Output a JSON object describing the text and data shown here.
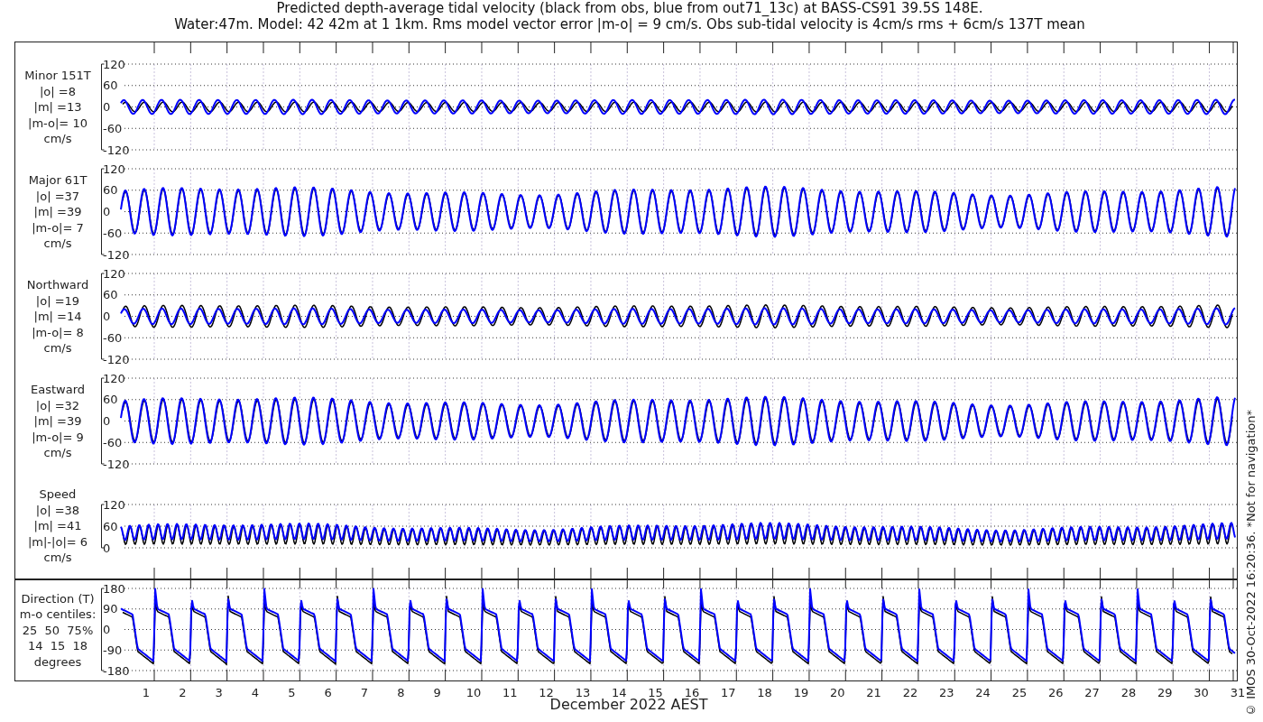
{
  "title": {
    "line1": "Predicted depth-average tidal velocity (black from obs, blue from out71_13c) at BASS-CS91 39.5S 148E.",
    "line2": "Water:47m. Model: 42 42m at 1 1km. Rms model vector error |m-o| = 9 cm/s. Obs sub-tidal velocity is 4cm/s rms + 6cm/s 137T mean"
  },
  "series": [
    {
      "color": "#000000"
    },
    {
      "color": "#0000ff"
    }
  ],
  "panels": [
    {
      "kind": "velocity",
      "label_lines": [
        "Minor 151T",
        "|o| =8",
        "|m| =13",
        "|m-o|= 10",
        "cm/s"
      ],
      "yticks": [
        "120",
        "60",
        "0",
        "-60",
        "-120"
      ]
    },
    {
      "kind": "velocity",
      "label_lines": [
        "Major 61T",
        "|o| =37",
        "|m| =39",
        "|m-o|= 7",
        "cm/s"
      ],
      "yticks": [
        "120",
        "60",
        "0",
        "-60",
        "-120"
      ]
    },
    {
      "kind": "velocity",
      "label_lines": [
        "Northward",
        "|o| =19",
        "|m| =14",
        "|m-o|= 8",
        "cm/s"
      ],
      "yticks": [
        "120",
        "60",
        "0",
        "-60",
        "-120"
      ]
    },
    {
      "kind": "velocity",
      "label_lines": [
        "Eastward",
        "|o| =32",
        "|m| =39",
        "|m-o|= 9",
        "cm/s"
      ],
      "yticks": [
        "120",
        "60",
        "0",
        "-60",
        "-120"
      ]
    },
    {
      "kind": "speed",
      "label_lines": [
        "Speed",
        "|o| =38",
        "|m| =41",
        "|m|-|o|= 6",
        "cm/s"
      ],
      "yticks": [
        "120",
        "60",
        "0"
      ]
    },
    {
      "kind": "direction",
      "label_lines": [
        "Direction (T)",
        "m-o centiles:",
        "25  50  75%",
        "14  15  18",
        "degrees"
      ],
      "yticks": [
        "180",
        "90",
        "0",
        "-90",
        "-180"
      ]
    }
  ],
  "x_axis": {
    "ticks": [
      "1",
      "2",
      "3",
      "4",
      "5",
      "6",
      "7",
      "8",
      "9",
      "10",
      "11",
      "12",
      "13",
      "14",
      "15",
      "16",
      "17",
      "18",
      "19",
      "20",
      "21",
      "22",
      "23",
      "24",
      "25",
      "26",
      "27",
      "28",
      "29",
      "30",
      "31"
    ],
    "label": "December 2022 AEST"
  },
  "credit": "© IMOS 30-Oct-2022 16:20:36. *Not for navigation*"
}
